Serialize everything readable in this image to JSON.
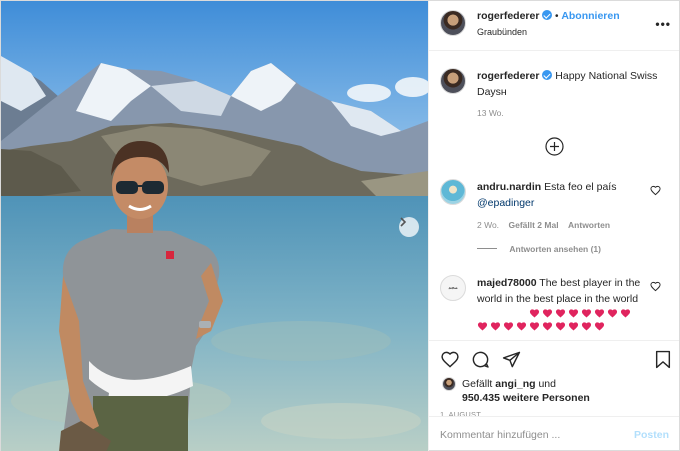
{
  "header": {
    "username": "rogerfederer",
    "follow_label": "Abonnieren",
    "location": "Graubünden",
    "more_label": "•••"
  },
  "caption": {
    "username": "rogerfederer",
    "text": "Happy National Swiss Daysʜ",
    "time": "13 Wo."
  },
  "comments": [
    {
      "username": "andru.nardin",
      "text": "Esta feo el país",
      "mention": "@epadinger",
      "time": "2 Wo.",
      "likes": "Gefällt 2 Mal",
      "reply_label": "Antworten",
      "view_replies": "Antworten ansehen (1)"
    },
    {
      "username": "majed78000",
      "avatar_text": "ﻣﺠﺪ",
      "text": "The best player in the world in the best place in the world",
      "heart_count_row1": 8,
      "heart_count_row2": 10
    }
  ],
  "likes": {
    "prefix": "Gefällt",
    "user": "angi_ng",
    "suffix": "und",
    "count": "950.435 weitere Personen"
  },
  "date": "1. AUGUST",
  "comment_box": {
    "placeholder": "Kommentar hinzufügen ...",
    "post_label": "Posten"
  },
  "colors": {
    "accent": "#3897f0",
    "heart": "#e0245e",
    "muted": "#8e8e8e"
  },
  "icons": [
    "heart-icon",
    "comment-icon",
    "share-icon",
    "bookmark-icon",
    "add-circle-icon",
    "chevron-right-icon",
    "verified-icon"
  ]
}
